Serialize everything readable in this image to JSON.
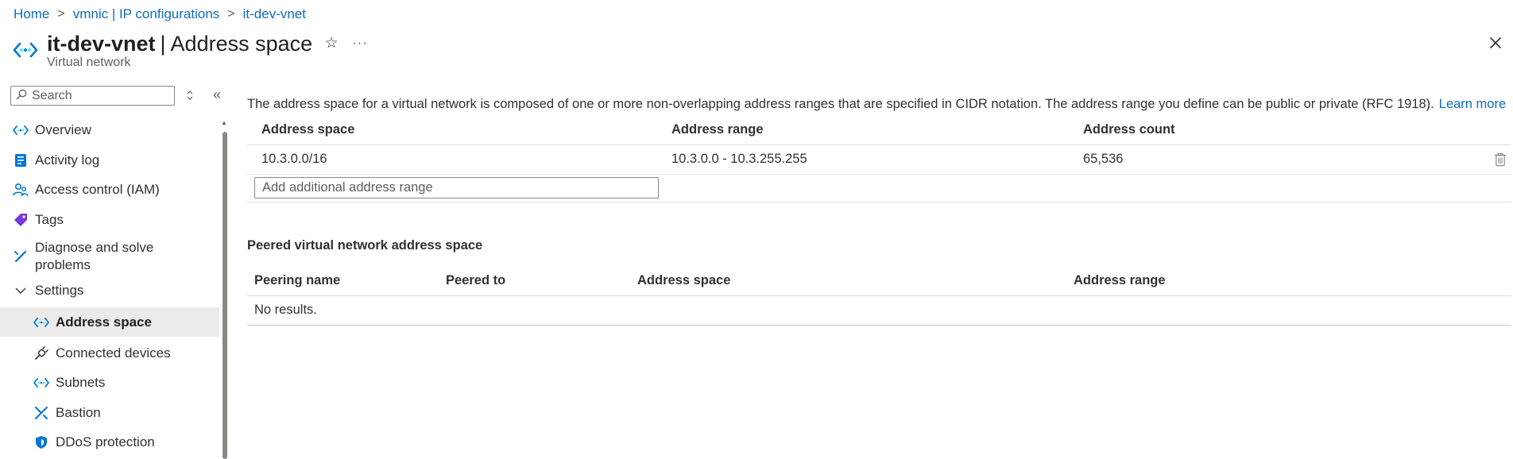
{
  "breadcrumb": [
    {
      "label": "Home"
    },
    {
      "label": "vmnic | IP configurations"
    },
    {
      "label": "it-dev-vnet"
    }
  ],
  "header": {
    "resource_name": "it-dev-vnet",
    "page_name": "Address space",
    "separator": "|",
    "subtitle": "Virtual network",
    "icon": "virtual-network-icon"
  },
  "search": {
    "placeholder": "Search",
    "value": ""
  },
  "sidebar": {
    "items": [
      {
        "label": "Overview",
        "icon": "vnet-icon"
      },
      {
        "label": "Activity log",
        "icon": "activity-log-icon"
      },
      {
        "label": "Access control (IAM)",
        "icon": "people-icon"
      },
      {
        "label": "Tags",
        "icon": "tag-icon"
      },
      {
        "label": "Diagnose and solve",
        "label2": "problems",
        "icon": "wrench-icon"
      },
      {
        "label": "Settings",
        "icon": "chevron-down-icon",
        "expanded": true
      },
      {
        "label": "Address space",
        "icon": "vnet-icon",
        "active": true
      },
      {
        "label": "Connected devices",
        "icon": "plug-icon"
      },
      {
        "label": "Subnets",
        "icon": "vnet-icon"
      },
      {
        "label": "Bastion",
        "icon": "bastion-icon"
      },
      {
        "label": "DDoS protection",
        "icon": "shield-icon"
      }
    ]
  },
  "main": {
    "description": "The address space for a virtual network is composed of one or more non-overlapping address ranges that are specified in CIDR notation. The address range you define can be public or private (RFC 1918).",
    "learn_more": "Learn more",
    "address_table": {
      "columns": [
        "Address space",
        "Address range",
        "Address count"
      ],
      "rows": [
        {
          "space": "10.3.0.0/16",
          "range": "10.3.0.0 - 10.3.255.255",
          "count": "65,536"
        }
      ],
      "add_placeholder": "Add additional address range"
    },
    "peered": {
      "title": "Peered virtual network address space",
      "columns": [
        "Peering name",
        "Peered to",
        "Address space",
        "Address range"
      ],
      "empty_text": "No results."
    }
  },
  "colors": {
    "link": "#0f6cbd",
    "active_bg": "#edebe9",
    "vnet_icon": "#0078d4",
    "divider": "#e1dfdd"
  }
}
